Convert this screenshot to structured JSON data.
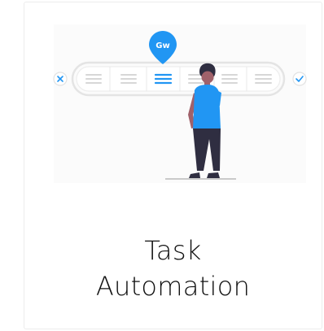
{
  "card": {
    "title_line1": "Task",
    "title_line2": "Automation"
  },
  "badge": {
    "label": "Gw"
  },
  "colors": {
    "accent": "#2196f3",
    "skin": "#a0616a",
    "hair": "#2f2e41",
    "pill_border": "#e6e6e6",
    "line_gray": "#d6d6d6",
    "ground": "#cacaca",
    "cancel_icon": "#2196f3",
    "confirm_icon": "#2196f3"
  },
  "icons": {
    "cancel": "close-icon",
    "confirm": "check-icon",
    "badge": "map-pin-icon",
    "options": "list-icon"
  }
}
